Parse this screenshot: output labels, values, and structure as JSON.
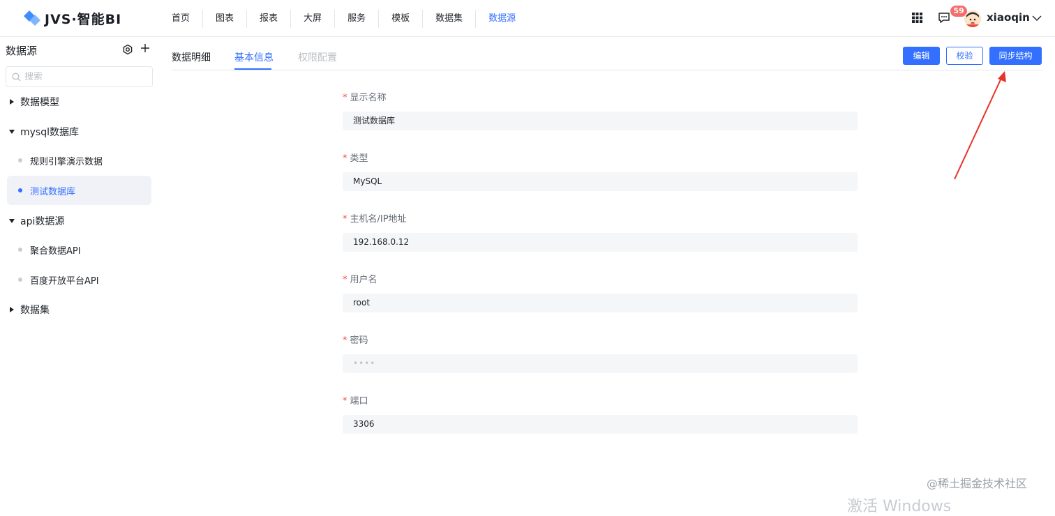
{
  "app": {
    "logo_text": "JVS·智能BI"
  },
  "nav": {
    "items": [
      "首页",
      "图表",
      "报表",
      "大屏",
      "服务",
      "模板",
      "数据集",
      "数据源"
    ],
    "active_index": 7
  },
  "header": {
    "badge_count": "59",
    "username": "xiaoqin"
  },
  "sidebar": {
    "title": "数据源",
    "search_placeholder": "搜索",
    "groups": [
      {
        "label": "数据模型",
        "expanded": false
      },
      {
        "label": "mysql数据库",
        "expanded": true,
        "children": [
          "规则引擎演示数据",
          "测试数据库"
        ]
      },
      {
        "label": "api数据源",
        "expanded": true,
        "children": [
          "聚合数据API",
          "百度开放平台API"
        ]
      },
      {
        "label": "数据集",
        "expanded": false
      }
    ],
    "active_leaf": "测试数据库"
  },
  "tabs": {
    "items": [
      "数据明细",
      "基本信息",
      "权限配置"
    ],
    "active": "基本信息",
    "disabled": "权限配置"
  },
  "actions": {
    "edit": "编辑",
    "verify": "校验",
    "sync": "同步结构"
  },
  "form": {
    "required_mark": "*",
    "fields": [
      {
        "label": "显示名称",
        "value": "测试数据库"
      },
      {
        "label": "类型",
        "value": "MySQL"
      },
      {
        "label": "主机名/IP地址",
        "value": "192.168.0.12"
      },
      {
        "label": "用户名",
        "value": "root"
      },
      {
        "label": "密码",
        "value": "••••"
      },
      {
        "label": "端口",
        "value": "3306"
      }
    ]
  },
  "watermark": "@稀土掘金技术社区",
  "os_overlay": "激活 Windows",
  "colors": {
    "accent": "#3370ff",
    "badge": "#f56c6c",
    "required": "#f54a45",
    "arrow": "#e8332a"
  }
}
